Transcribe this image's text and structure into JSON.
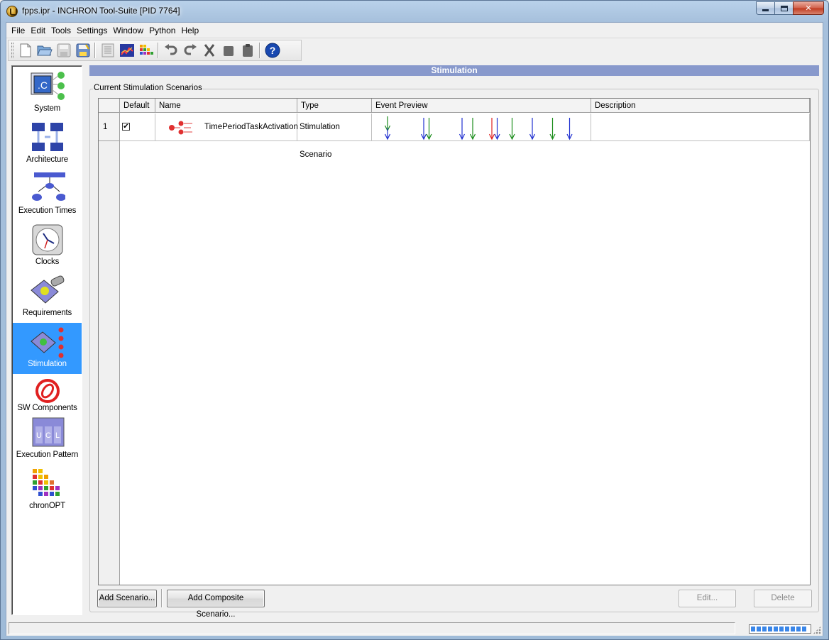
{
  "window": {
    "title": "fpps.ipr - INCHRON Tool-Suite [PID 7764]",
    "controls": {
      "minimize": "minimize",
      "maximize": "maximize",
      "close": "✕"
    }
  },
  "menu": [
    "File",
    "Edit",
    "Tools",
    "Settings",
    "Window",
    "Python",
    "Help"
  ],
  "toolbar": {
    "groups": [
      [
        "new-file-icon",
        "open-folder-icon",
        "save-icon",
        "save-as-icon"
      ],
      [
        "project-properties-icon",
        "chart-view-icon",
        "chronopt-icon"
      ],
      [
        "undo-icon",
        "redo-icon",
        "cut-icon",
        "copy-icon",
        "paste-icon"
      ],
      [
        "help-icon"
      ]
    ]
  },
  "nav": {
    "items": [
      {
        "label": "System",
        "icon": "system-icon"
      },
      {
        "label": "Architecture",
        "icon": "architecture-icon"
      },
      {
        "label": "Execution Times",
        "icon": "execution-times-icon"
      },
      {
        "label": "Clocks",
        "icon": "clock-icon"
      },
      {
        "label": "Requirements",
        "icon": "requirements-icon"
      },
      {
        "label": "Stimulation",
        "icon": "stimulation-icon",
        "active": true
      },
      {
        "label": "SW Components",
        "icon": "sw-components-icon"
      },
      {
        "label": "Execution Pattern",
        "icon": "execution-pattern-icon"
      },
      {
        "label": "chronOPT",
        "icon": "chronopt-icon"
      }
    ]
  },
  "section": {
    "title": "Stimulation",
    "group_title": "Current Stimulation Scenarios"
  },
  "table": {
    "columns": [
      "Default",
      "Name",
      "Type",
      "Event Preview",
      "Description"
    ],
    "rows": [
      {
        "index": "1",
        "default_checked": true,
        "checkmark": "✔",
        "name": "TimePeriodTaskActivation",
        "type": "Stimulation Scenario",
        "description": "",
        "event_preview": [
          {
            "pos": 0.06,
            "color": "#1a8c1a",
            "level": "top"
          },
          {
            "pos": 0.06,
            "color": "#2030d0",
            "level": "bottom"
          },
          {
            "pos": 0.23,
            "color": "#2030d0",
            "level": "full"
          },
          {
            "pos": 0.255,
            "color": "#1a8c1a",
            "level": "full"
          },
          {
            "pos": 0.41,
            "color": "#2030d0",
            "level": "full"
          },
          {
            "pos": 0.46,
            "color": "#1a8c1a",
            "level": "full"
          },
          {
            "pos": 0.55,
            "color": "#e02020",
            "level": "full"
          },
          {
            "pos": 0.575,
            "color": "#2030d0",
            "level": "full"
          },
          {
            "pos": 0.645,
            "color": "#1a8c1a",
            "level": "full"
          },
          {
            "pos": 0.74,
            "color": "#2030d0",
            "level": "full"
          },
          {
            "pos": 0.835,
            "color": "#1a8c1a",
            "level": "full"
          },
          {
            "pos": 0.915,
            "color": "#2030d0",
            "level": "full"
          }
        ]
      }
    ]
  },
  "buttons": {
    "add_scenario": "Add Scenario...",
    "add_composite": "Add Composite Scenario...",
    "edit": "Edit...",
    "delete": "Delete"
  },
  "colors": {
    "active_nav": "#3399ff",
    "section_header": "#8899cc",
    "progress": "#3a86e8"
  }
}
